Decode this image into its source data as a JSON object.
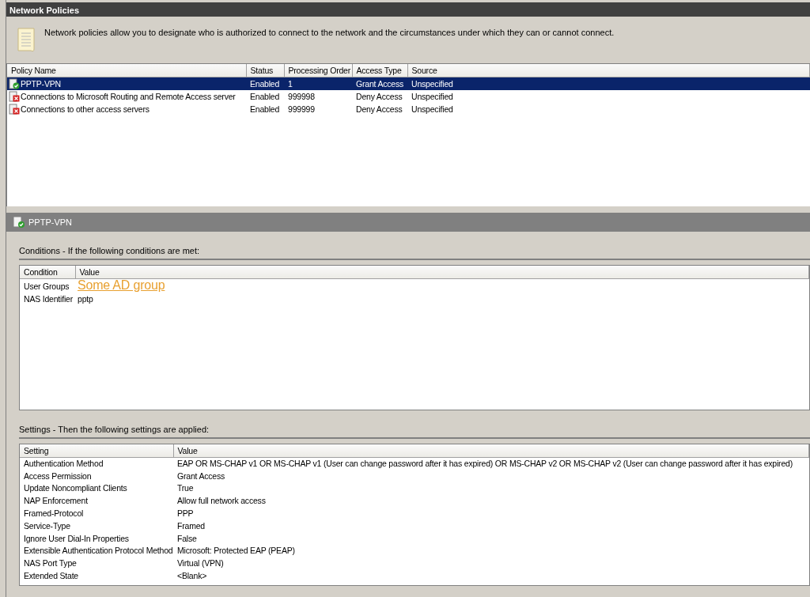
{
  "panel_title": "Network Policies",
  "description": "Network policies allow you to designate who is authorized to connect to the network and the circumstances under which they can or cannot connect.",
  "policies": {
    "columns": [
      "Policy Name",
      "Status",
      "Processing Order",
      "Access Type",
      "Source"
    ],
    "rows": [
      {
        "name": "PPTP-VPN",
        "status": "Enabled",
        "order": "1",
        "access": "Grant Access",
        "source": "Unspecified",
        "kind": "grant",
        "selected": true
      },
      {
        "name": "Connections to Microsoft Routing and Remote Access server",
        "status": "Enabled",
        "order": "999998",
        "access": "Deny Access",
        "source": "Unspecified",
        "kind": "deny",
        "selected": false
      },
      {
        "name": "Connections to other access servers",
        "status": "Enabled",
        "order": "999999",
        "access": "Deny Access",
        "source": "Unspecified",
        "kind": "deny",
        "selected": false
      }
    ]
  },
  "details": {
    "title": "PPTP-VPN",
    "conditions": {
      "heading": "Conditions - If the following conditions are met:",
      "columns": [
        "Condition",
        "Value"
      ],
      "rows": [
        {
          "condition": "User Groups",
          "value": "Some AD group",
          "kind": "highlight"
        },
        {
          "condition": "NAS Identifier",
          "value": "pptp",
          "kind": "text"
        }
      ]
    },
    "settings": {
      "heading": "Settings - Then the following settings are applied:",
      "columns": [
        "Setting",
        "Value"
      ],
      "rows": [
        {
          "setting": "Authentication Method",
          "value": "EAP OR MS-CHAP v1 OR MS-CHAP v1 (User can change password after it has expired) OR MS-CHAP v2 OR MS-CHAP v2 (User can change password after it has expired)"
        },
        {
          "setting": "Access Permission",
          "value": "Grant Access"
        },
        {
          "setting": "Update Noncompliant Clients",
          "value": "True"
        },
        {
          "setting": "NAP Enforcement",
          "value": "Allow full network access"
        },
        {
          "setting": "Framed-Protocol",
          "value": "PPP"
        },
        {
          "setting": "Service-Type",
          "value": "Framed"
        },
        {
          "setting": "Ignore User Dial-In Properties",
          "value": "False"
        },
        {
          "setting": "Extensible Authentication Protocol Method",
          "value": "Microsoft: Protected EAP (PEAP)"
        },
        {
          "setting": "NAS Port Type",
          "value": "Virtual (VPN)"
        },
        {
          "setting": "Extended State",
          "value": "<Blank>"
        }
      ]
    }
  }
}
